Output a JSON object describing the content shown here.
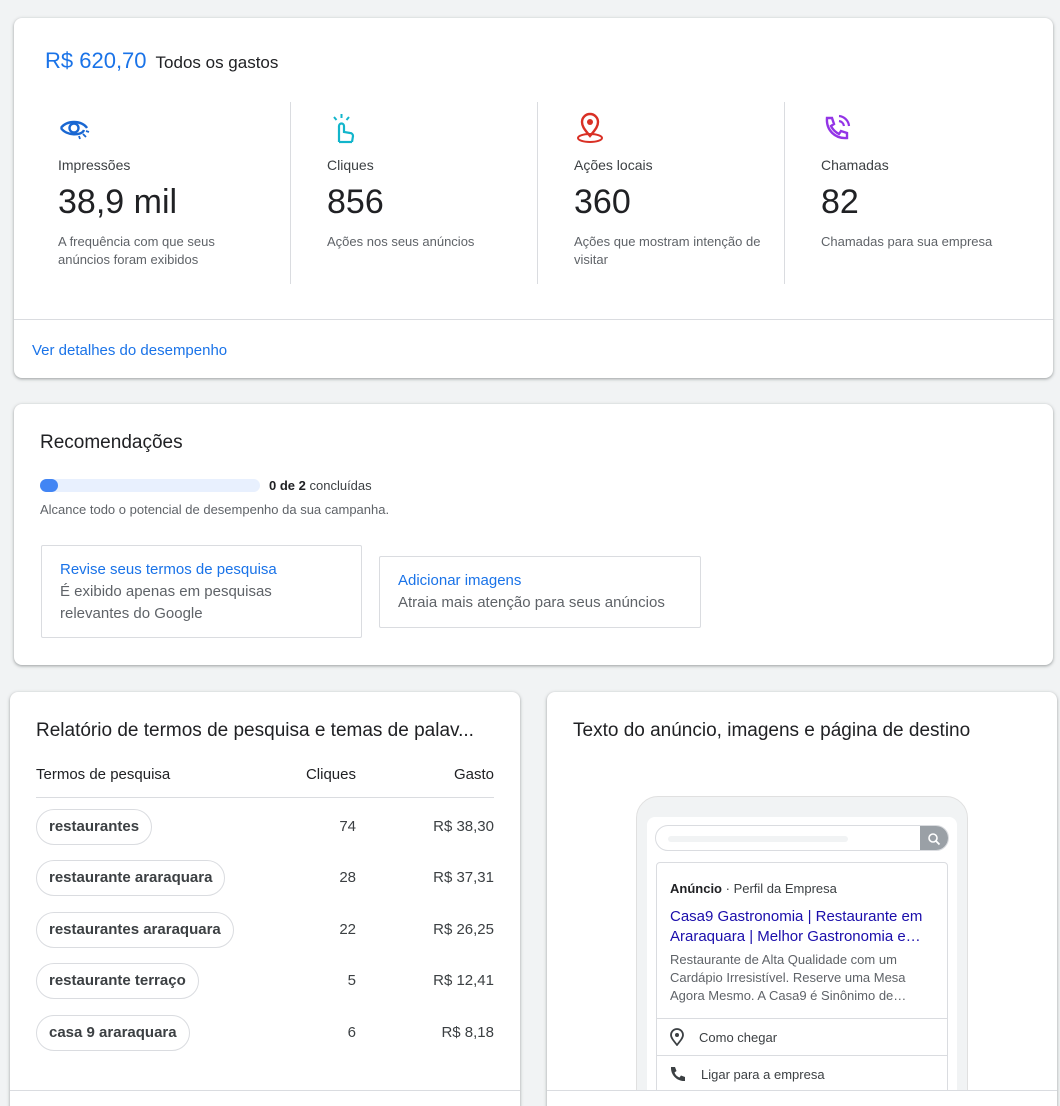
{
  "performance": {
    "spend_amount": "R$ 620,70",
    "spend_label": "Todos os gastos",
    "metrics": [
      {
        "icon": "eye-icon",
        "color": "#1967d2",
        "label": "Impressões",
        "value": "38,9 mil",
        "desc": "A frequência com que seus anúncios foram exibidos"
      },
      {
        "icon": "tap-icon",
        "color": "#12b5cb",
        "label": "Cliques",
        "value": "856",
        "desc": "Ações nos seus anúncios"
      },
      {
        "icon": "location-pin-icon",
        "color": "#d93025",
        "label": "Ações locais",
        "value": "360",
        "desc": "Ações que mostram intenção de visitar"
      },
      {
        "icon": "phone-call-icon",
        "color": "#9334e6",
        "label": "Chamadas",
        "value": "82",
        "desc": "Chamadas para sua empresa"
      }
    ],
    "details_link": "Ver detalhes do desempenho"
  },
  "recommendations": {
    "title": "Recomendações",
    "progress_done": "0 de 2",
    "progress_suffix": "concluídas",
    "progress_fraction": 0.04,
    "description": "Alcance todo o potencial de desempenho da sua campanha.",
    "items": [
      {
        "title": "Revise seus termos de pesquisa",
        "desc": "É exibido apenas em pesquisas relevantes do Google"
      },
      {
        "title": "Adicionar imagens",
        "desc": "Atraia mais atenção para seus anúncios"
      }
    ]
  },
  "search_terms": {
    "title": "Relatório de termos de pesquisa e temas de palav...",
    "columns": {
      "term": "Termos de pesquisa",
      "clicks": "Cliques",
      "cost": "Gasto"
    },
    "rows": [
      {
        "term": "restaurantes",
        "clicks": "74",
        "cost": "R$ 38,30"
      },
      {
        "term": "restaurante araraquara",
        "clicks": "28",
        "cost": "R$ 37,31"
      },
      {
        "term": "restaurantes araraquara",
        "clicks": "22",
        "cost": "R$ 26,25"
      },
      {
        "term": "restaurante terraço",
        "clicks": "5",
        "cost": "R$ 12,41"
      },
      {
        "term": "casa 9 araraquara",
        "clicks": "6",
        "cost": "R$ 8,18"
      }
    ]
  },
  "ad_preview": {
    "title": "Texto do anúncio, imagens e página de destino",
    "ad_label": "Anúncio",
    "ad_source": "· Perfil da Empresa",
    "headline": "Casa9 Gastronomia | Restaurante em Araraquara | Melhor Gastronomia e…",
    "description": "Restaurante de Alta Qualidade com um Cardápio Irresistível. Reserve uma Mesa Agora Mesmo. A Casa9 é Sinônimo de…",
    "actions": [
      {
        "icon": "location-pin-icon",
        "label": "Como chegar"
      },
      {
        "icon": "phone-icon",
        "label": "Ligar para a empresa"
      }
    ]
  }
}
